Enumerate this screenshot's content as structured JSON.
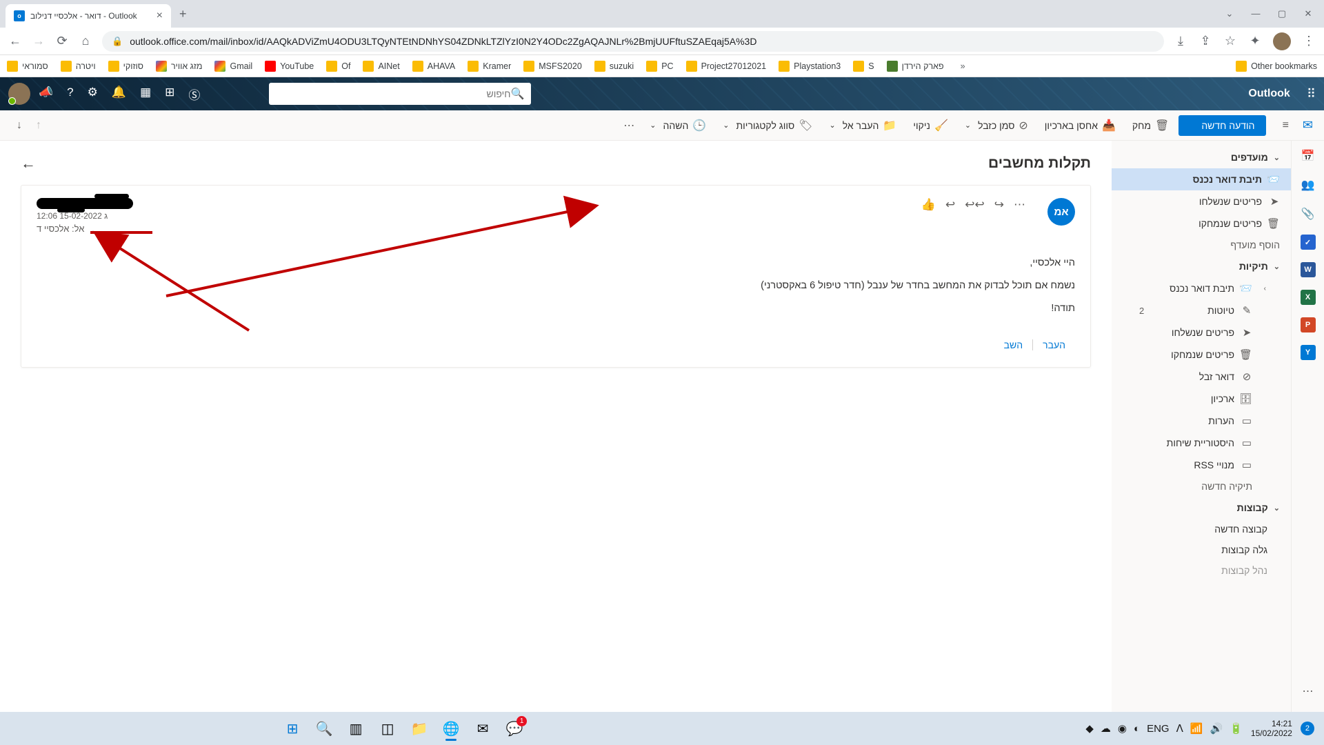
{
  "browser": {
    "tab_title": "דואר - אלכסיי דנילוב - Outlook",
    "url": "outlook.office.com/mail/inbox/id/AAQkADViZmU4ODU3LTQyNTEtNDNhYS04ZDNkLTZlYzI0N2Y4ODc2ZgAQAJNLr%2BmjUUFftuSZAEqaj5A%3D",
    "other_bookmarks": "Other bookmarks",
    "bookmarks": [
      "סמוראי",
      "ויטרה",
      "סוזוקי",
      "מזג אוויר",
      "Gmail",
      "YouTube",
      "Of",
      "AINet",
      "AHAVA",
      "Kramer",
      "MSFS2020",
      "suzuki",
      "PC",
      "Project27012021",
      "Playstation3",
      "S",
      "פארק הירדן"
    ]
  },
  "owa": {
    "brand": "Outlook",
    "search_placeholder": "חיפוש"
  },
  "ribbon": {
    "new_message": "הודעה חדשה",
    "delete": "מחק",
    "archive": "אחסן בארכיון",
    "junk": "סמן כזבל",
    "sweep": "ניקוי",
    "move": "העבר אל",
    "categorize": "סווג לקטגוריות",
    "snooze": "השהה"
  },
  "folders": {
    "favorites": "מועדפים",
    "inbox": "תיבת דואר נכנס",
    "sent": "פריטים שנשלחו",
    "deleted": "פריטים שנמחקו",
    "add_favorite": "הוסף מועדף",
    "folders_header": "תיקיות",
    "drafts": "טיוטות",
    "drafts_count": "2",
    "junk": "דואר זבל",
    "archive": "ארכיון",
    "notes": "הערות",
    "history": "היסטוריית שיחות",
    "rss": "מנויי RSS",
    "new_folder": "תיקיה חדשה",
    "groups_header": "קבוצות",
    "new_group": "קבוצה חדשה",
    "discover": "גלה קבוצות",
    "manage": "נהל קבוצות"
  },
  "message": {
    "subject": "תקלות מחשבים",
    "avatar_initials": "אמ",
    "date": "ג 15-02-2022 12:06",
    "to_label": "אל: אלכסיי ד",
    "body_greeting": "היי אלכסיי,",
    "body_line": "נשמח אם תוכל לבדוק את המחשב בחדר של ענבל (חדר טיפול 6 באקסטרני)",
    "body_thanks": "תודה!",
    "reply": "השב",
    "forward": "העבר"
  },
  "taskbar": {
    "lang": "ENG",
    "time": "14:21",
    "date": "15/02/2022",
    "notif_count": "2",
    "whatsapp_badge": "1"
  }
}
